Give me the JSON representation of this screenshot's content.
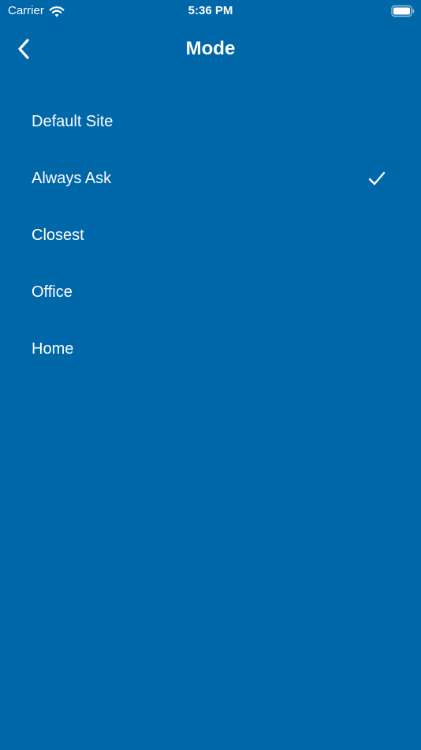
{
  "status_bar": {
    "carrier": "Carrier",
    "time": "5:36 PM",
    "wifi_icon": "wifi-icon",
    "battery_icon": "battery-icon"
  },
  "nav": {
    "title": "Mode",
    "back_icon": "chevron-left-icon"
  },
  "options": [
    {
      "label": "Default Site",
      "selected": false
    },
    {
      "label": "Always Ask",
      "selected": true
    },
    {
      "label": "Closest",
      "selected": false
    },
    {
      "label": "Office",
      "selected": false
    },
    {
      "label": "Home",
      "selected": false
    }
  ],
  "colors": {
    "background": "#0067a8",
    "text": "#ffffff"
  }
}
